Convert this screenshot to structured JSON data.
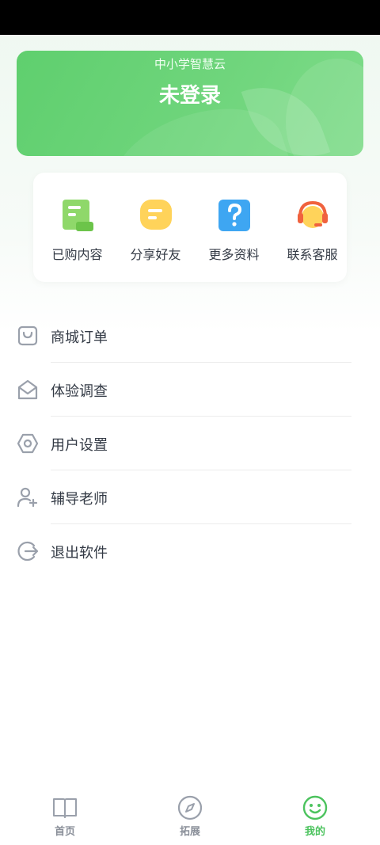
{
  "banner": {
    "subtitle": "中小学智慧云",
    "title": "未登录"
  },
  "quick_actions": [
    {
      "label": "已购内容",
      "icon": "purchased-doc-icon",
      "color": "#8fd86a"
    },
    {
      "label": "分享好友",
      "icon": "share-chat-icon",
      "color": "#ffd35a"
    },
    {
      "label": "更多资料",
      "icon": "question-icon",
      "color": "#3ea6f2"
    },
    {
      "label": "联系客服",
      "icon": "customer-service-icon",
      "color": "#f0623e"
    }
  ],
  "menu": [
    {
      "label": "商城订单",
      "icon": "shopping-bag-icon"
    },
    {
      "label": "体验调查",
      "icon": "envelope-icon"
    },
    {
      "label": "用户设置",
      "icon": "settings-hexagon-icon"
    },
    {
      "label": "辅导老师",
      "icon": "add-user-icon"
    },
    {
      "label": "退出软件",
      "icon": "logout-icon"
    }
  ],
  "tabbar": {
    "tabs": [
      {
        "label": "首页",
        "icon": "book-icon",
        "active": false
      },
      {
        "label": "拓展",
        "icon": "compass-icon",
        "active": false
      },
      {
        "label": "我的",
        "icon": "smiley-icon",
        "active": true
      }
    ]
  },
  "colors": {
    "accent": "#4cc35e",
    "banner": "#6fd57c",
    "text": "#333a45",
    "icon_gray": "#9aa0ab"
  }
}
